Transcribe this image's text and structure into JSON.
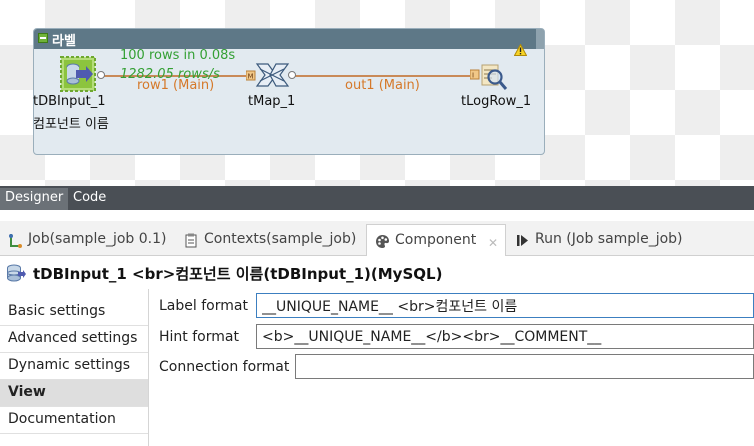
{
  "canvas": {
    "subjob_title": "라벨",
    "stats": {
      "rows": "100 rows in 0.08s",
      "rate": "1282.05 rows/s"
    },
    "components": [
      {
        "name": "tDBInput_1",
        "label_line2": "컴포넌트 이름"
      },
      {
        "name": "tMap_1"
      },
      {
        "name": "tLogRow_1"
      }
    ],
    "flows": [
      {
        "label": "row1 (Main)"
      },
      {
        "label": "out1 (Main)"
      }
    ]
  },
  "designer_tabs": {
    "designer": "Designer",
    "code": "Code"
  },
  "view_tabs": [
    {
      "label": "Job(sample_job 0.1)"
    },
    {
      "label": "Contexts(sample_job)"
    },
    {
      "label": "Component",
      "close": "✕"
    },
    {
      "label": "Run (Job sample_job)"
    }
  ],
  "component_title": "tDBInput_1  <br>컴포넌트 이름(tDBInput_1)(MySQL)",
  "nav_items": [
    {
      "label": "Basic settings"
    },
    {
      "label": "Advanced settings"
    },
    {
      "label": "Dynamic settings"
    },
    {
      "label": "View"
    },
    {
      "label": "Documentation"
    }
  ],
  "form": {
    "label_format": {
      "label": "Label format",
      "value": "__UNIQUE_NAME__ <br>컴포넌트 이름"
    },
    "hint_format": {
      "label": "Hint format",
      "value": "<b>__UNIQUE_NAME__</b><br>__COMMENT__"
    },
    "connection_format": {
      "label": "Connection format",
      "value": ""
    }
  },
  "colors": {
    "subjob_header": "#5e7887",
    "subjob_body": "#e2eaf0",
    "flow_label": "#d5792a",
    "stats": "#34a034",
    "focus_border": "#3c7fc0"
  }
}
